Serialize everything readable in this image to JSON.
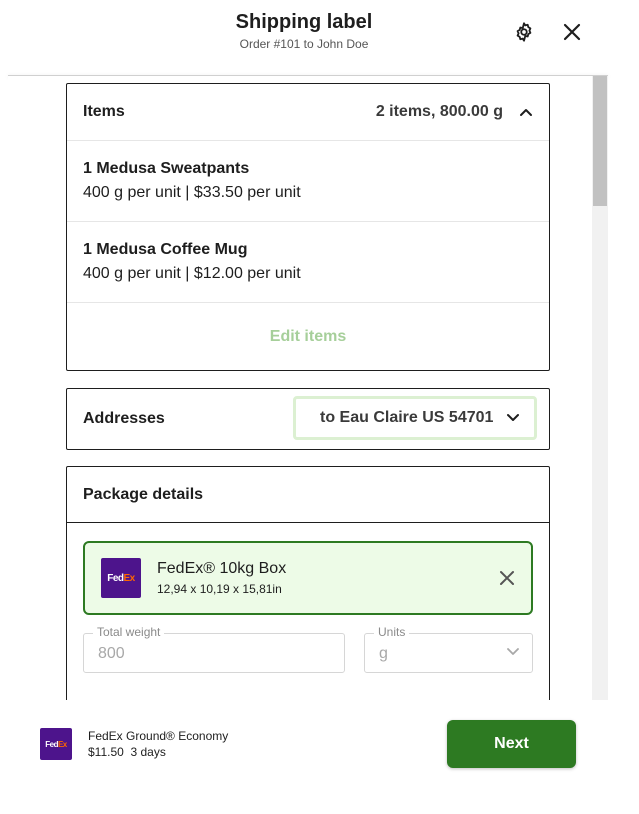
{
  "header": {
    "title": "Shipping label",
    "subtitle": "Order #101 to John Doe",
    "settings_icon": "gear-icon",
    "close_icon": "close-icon"
  },
  "items_card": {
    "title": "Items",
    "summary": "2 items, 800.00 g",
    "toggle_icon": "chevron-up-icon",
    "items": [
      {
        "name": "1 Medusa Sweatpants",
        "meta": "400 g per unit | $33.50 per unit"
      },
      {
        "name": "1 Medusa Coffee Mug",
        "meta": "400 g per unit | $12.00 per unit"
      }
    ],
    "edit_label": "Edit items"
  },
  "addresses_card": {
    "title": "Addresses",
    "selected": "to Eau Claire US 54701"
  },
  "package_card": {
    "title": "Package details",
    "package": {
      "name": "FedEx® 10kg Box",
      "dimensions": "12,94 x 10,19 x 15,81in",
      "logo_text_a": "Fed",
      "logo_text_b": "Ex"
    },
    "weight": {
      "label": "Total weight",
      "placeholder": "800"
    },
    "units": {
      "label": "Units",
      "value": "g"
    }
  },
  "footer": {
    "service": "FedEx Ground® Economy",
    "price": "$11.50",
    "transit": "3 days",
    "next_label": "Next"
  },
  "colors": {
    "primary_green": "#2d7a22",
    "selected_bg": "#edfbe7",
    "fedex_purple": "#4d148c",
    "fedex_orange": "#ff6600",
    "disabled_link": "#a6cf9a"
  }
}
